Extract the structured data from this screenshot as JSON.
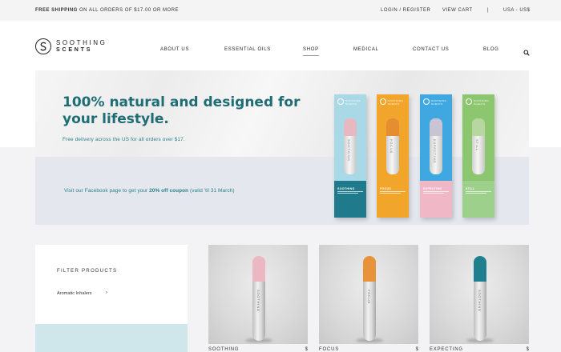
{
  "topbar": {
    "promo_bold": "FREE SHIPPING",
    "promo_rest": " ON ALL ORDERS OF $17.00 OR MORE",
    "login": "LOGIN / REGISTER",
    "view_cart": "VIEW CART",
    "separator": "|",
    "locale": "USA - US$"
  },
  "brand": {
    "line1": "SOOTHING",
    "line2": "SCENTS"
  },
  "nav": [
    {
      "label": "ABOUT US"
    },
    {
      "label": "ESSENTIAL OILS"
    },
    {
      "label": "SHOP"
    },
    {
      "label": "MEDICAL"
    },
    {
      "label": "CONTACT US"
    },
    {
      "label": "BLOG"
    }
  ],
  "nav_active": "SHOP",
  "hero": {
    "title": "100% natural and designed for your lifestyle.",
    "subtitle": "Free delivery across the US for all orders over $17.",
    "fb_before": "Visit our Facebook page to get your ",
    "fb_bold": "20% off coupon",
    "fb_after": " (valid 'til 31 March)",
    "boxes": [
      {
        "brand": "SOOTHING SCENTS",
        "name": "SOOTHING",
        "vertical": "SOOTHING",
        "top_color": "#a9d8e6",
        "bottom_color": "#1f7b8c",
        "cap_color": "#e8b8c0"
      },
      {
        "brand": "SOOTHING SCENTS",
        "name": "FOCUS",
        "vertical": "FOCUS",
        "top_color": "#f2a52b",
        "bottom_color": "#f2a52b",
        "cap_color": "#e58d2f"
      },
      {
        "brand": "SOOTHING SCENTS",
        "name": "EXPECTING",
        "vertical": "EXPECTING",
        "top_color": "#3fa8e0",
        "bottom_color": "#f0b7c6",
        "cap_color": "#c9c4d4"
      },
      {
        "brand": "SOOTHING SCENTS",
        "name": "STILL",
        "vertical": "STILL",
        "top_color": "#8cc66e",
        "bottom_color": "#9dd08a",
        "cap_color": "#b8d6a0"
      }
    ]
  },
  "filter": {
    "title": "FILTER PRODUCTS",
    "option": "Aromatic Inhalers",
    "chevron": "›"
  },
  "products": [
    {
      "title": "SOOTHING",
      "price": "$",
      "cap_color": "#eab7c2",
      "vertical": "SOOTHING"
    },
    {
      "title": "FOCUS",
      "price": "$",
      "cap_color": "#e8923a",
      "vertical": "FOCUS"
    },
    {
      "title": "EXPECTING",
      "price": "$",
      "cap_color": "#1f7f8e",
      "vertical": "SOOTHING"
    }
  ],
  "colors": {
    "accent": "#1f6d74",
    "topbar_bg": "#f4f4f4",
    "page_bg": "#f3f3f5",
    "filter_teal": "#cfe7ea"
  },
  "icons": {
    "search": "search-icon",
    "logo": "brand-logo-icon"
  }
}
